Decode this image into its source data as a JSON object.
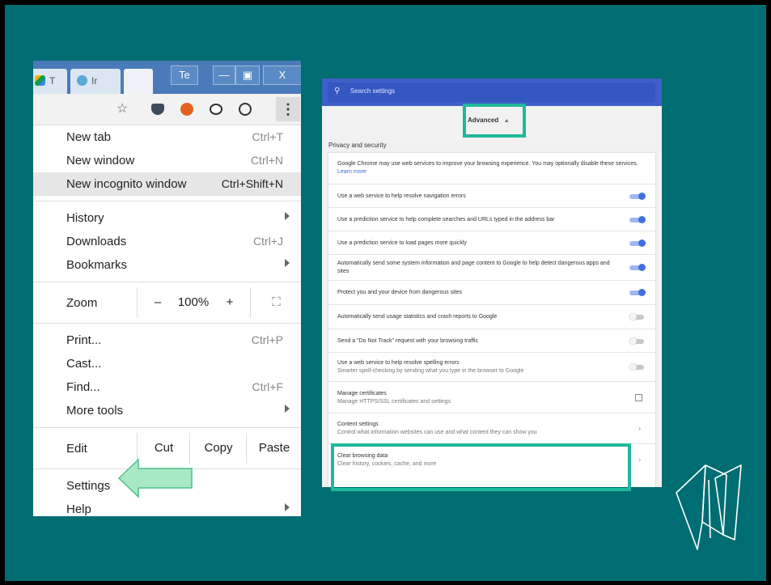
{
  "browser": {
    "tabs": [
      {
        "label": "T",
        "icon": "drive-icon"
      },
      {
        "label": "Ir",
        "icon": "globe-icon"
      },
      {
        "label": ""
      }
    ],
    "window": {
      "title_fragment": "Te",
      "min": "—",
      "max": "▣",
      "close": "X"
    },
    "toolbar_icons": [
      "star-icon",
      "pocket-icon",
      "duckduckgo-icon",
      "panda-icon",
      "pinterest-icon",
      "more-vert-icon"
    ]
  },
  "menu": {
    "group1": [
      {
        "label": "New tab",
        "shortcut": "Ctrl+T"
      },
      {
        "label": "New window",
        "shortcut": "Ctrl+N"
      },
      {
        "label": "New incognito window",
        "shortcut": "Ctrl+Shift+N",
        "highlighted": true
      }
    ],
    "group2": [
      {
        "label": "History",
        "submenu": true
      },
      {
        "label": "Downloads",
        "shortcut": "Ctrl+J"
      },
      {
        "label": "Bookmarks",
        "submenu": true
      }
    ],
    "zoom": {
      "label": "Zoom",
      "minus": "–",
      "value": "100%",
      "plus": "+",
      "fullscreen": "⛶"
    },
    "group3": [
      {
        "label": "Print...",
        "shortcut": "Ctrl+P"
      },
      {
        "label": "Cast..."
      },
      {
        "label": "Find...",
        "shortcut": "Ctrl+F"
      },
      {
        "label": "More tools",
        "submenu": true
      }
    ],
    "edit": {
      "label": "Edit",
      "cut": "Cut",
      "copy": "Copy",
      "paste": "Paste"
    },
    "group4": [
      {
        "label": "Settings"
      },
      {
        "label": "Help",
        "submenu": true
      }
    ]
  },
  "settings": {
    "search_placeholder": "Search settings",
    "advanced_label": "Advanced",
    "section_title": "Privacy and security",
    "intro": {
      "text": "Google Chrome may use web services to improve your browsing experience. You may optionally disable these services.",
      "link": "Learn more"
    },
    "rows": [
      {
        "title": "Use a web service to help resolve navigation errors",
        "toggle": "on"
      },
      {
        "title": "Use a prediction service to help complete searches and URLs typed in the address bar",
        "toggle": "on"
      },
      {
        "title": "Use a prediction service to load pages more quickly",
        "toggle": "on"
      },
      {
        "title": "Automatically send some system information and page content to Google to help detect dangerous apps and sites",
        "toggle": "on"
      },
      {
        "title": "Protect you and your device from dangerous sites",
        "toggle": "on"
      },
      {
        "title": "Automatically send usage statistics and crash reports to Google",
        "toggle": "off"
      },
      {
        "title": "Send a \"Do Not Track\" request with your browsing traffic",
        "toggle": "off"
      },
      {
        "title": "Use a web service to help resolve spelling errors",
        "sub": "Smarter spell-checking by sending what you type in the browser to Google",
        "toggle": "off"
      },
      {
        "title": "Manage certificates",
        "sub": "Manage HTTPS/SSL certificates and settings",
        "action": "external"
      },
      {
        "title": "Content settings",
        "sub": "Control what information websites can use and what content they can show you",
        "action": "chevron"
      },
      {
        "title": "Clear browsing data",
        "sub": "Clear history, cookies, cache, and more",
        "action": "chevron"
      }
    ]
  },
  "colors": {
    "slide_bg": "#006d72",
    "highlight": "#1fb89b",
    "arrow_fill": "#a8e8c4",
    "chrome_blue": "#3f60c9",
    "toggle_on": "#3f6fe0"
  }
}
